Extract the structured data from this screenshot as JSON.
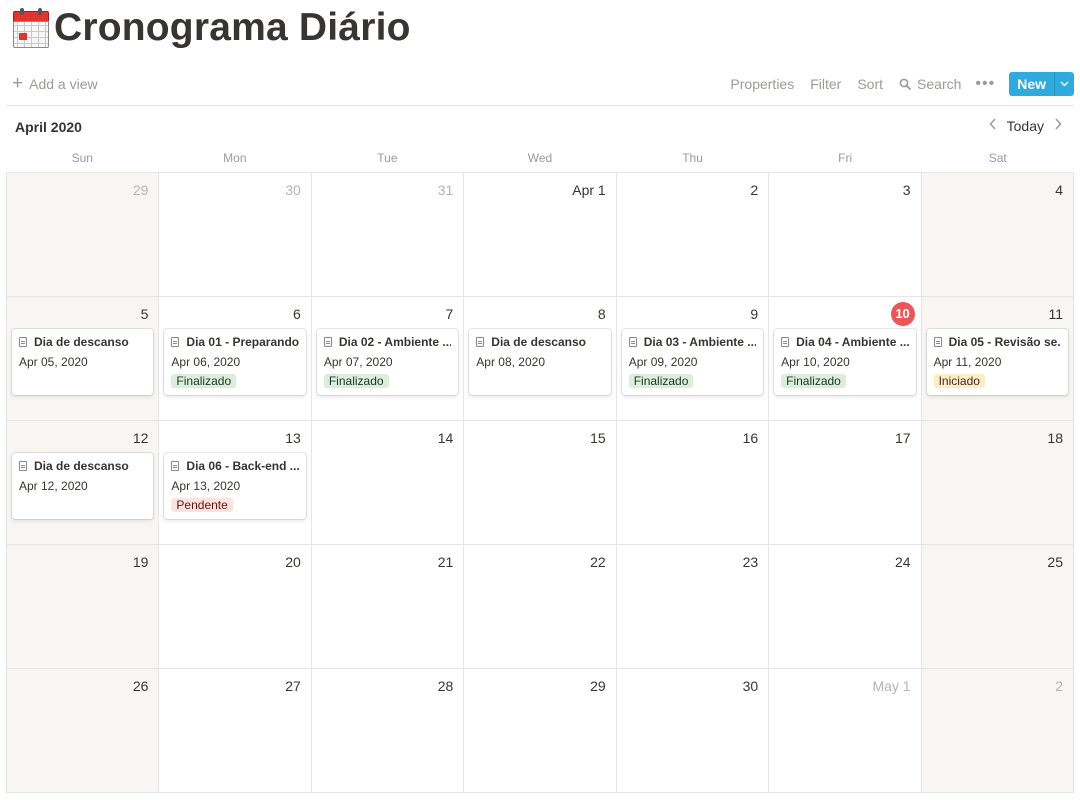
{
  "page": {
    "title": "Cronograma Diário",
    "icon": "calendar-emoji-icon"
  },
  "toolbar": {
    "add_view": "Add a view",
    "properties": "Properties",
    "filter": "Filter",
    "sort": "Sort",
    "search": "Search",
    "more": "•••",
    "new": "New"
  },
  "calendar": {
    "month_label": "April 2020",
    "today_label": "Today",
    "weekdays": [
      "Sun",
      "Mon",
      "Tue",
      "Wed",
      "Thu",
      "Fri",
      "Sat"
    ],
    "weeks": [
      [
        {
          "label": "29",
          "muted": true
        },
        {
          "label": "30",
          "muted": true
        },
        {
          "label": "31",
          "muted": true
        },
        {
          "label": "Apr 1"
        },
        {
          "label": "2"
        },
        {
          "label": "3"
        },
        {
          "label": "4"
        }
      ],
      [
        {
          "label": "5",
          "event": {
            "title": "Dia de descanso",
            "date": "Apr 05, 2020"
          }
        },
        {
          "label": "6",
          "event": {
            "title": "Dia 01 - Preparando...",
            "date": "Apr 06, 2020",
            "status": "Finalizado"
          }
        },
        {
          "label": "7",
          "event": {
            "title": "Dia 02 - Ambiente ...",
            "date": "Apr 07, 2020",
            "status": "Finalizado"
          }
        },
        {
          "label": "8",
          "event": {
            "title": "Dia de descanso",
            "date": "Apr 08, 2020"
          }
        },
        {
          "label": "9",
          "event": {
            "title": "Dia 03 - Ambiente ...",
            "date": "Apr 09, 2020",
            "status": "Finalizado"
          }
        },
        {
          "label": "10",
          "today": true,
          "event": {
            "title": "Dia 04 - Ambiente ...",
            "date": "Apr 10, 2020",
            "status": "Finalizado"
          }
        },
        {
          "label": "11",
          "event": {
            "title": "Dia 05 - Revisão se...",
            "date": "Apr 11, 2020",
            "status": "Iniciado"
          }
        }
      ],
      [
        {
          "label": "12",
          "event": {
            "title": "Dia de descanso",
            "date": "Apr 12, 2020"
          }
        },
        {
          "label": "13",
          "event": {
            "title": "Dia 06 - Back-end ...",
            "date": "Apr 13, 2020",
            "status": "Pendente"
          }
        },
        {
          "label": "14"
        },
        {
          "label": "15"
        },
        {
          "label": "16"
        },
        {
          "label": "17"
        },
        {
          "label": "18"
        }
      ],
      [
        {
          "label": "19"
        },
        {
          "label": "20"
        },
        {
          "label": "21"
        },
        {
          "label": "22"
        },
        {
          "label": "23"
        },
        {
          "label": "24"
        },
        {
          "label": "25"
        }
      ],
      [
        {
          "label": "26"
        },
        {
          "label": "27"
        },
        {
          "label": "28"
        },
        {
          "label": "29"
        },
        {
          "label": "30"
        },
        {
          "label": "May 1",
          "muted": true
        },
        {
          "label": "2",
          "muted": true
        }
      ]
    ]
  },
  "status_colors": {
    "Finalizado": {
      "bg": "#dbeddb",
      "fg": "#1c3829"
    },
    "Iniciado": {
      "bg": "#fdecc8",
      "fg": "#402c1b"
    },
    "Pendente": {
      "bg": "#ffe2dd",
      "fg": "#5d1715"
    }
  },
  "colors": {
    "accent": "#2eaadc",
    "today": "#eb5757",
    "weekend_bg": "#f7f6f3"
  }
}
